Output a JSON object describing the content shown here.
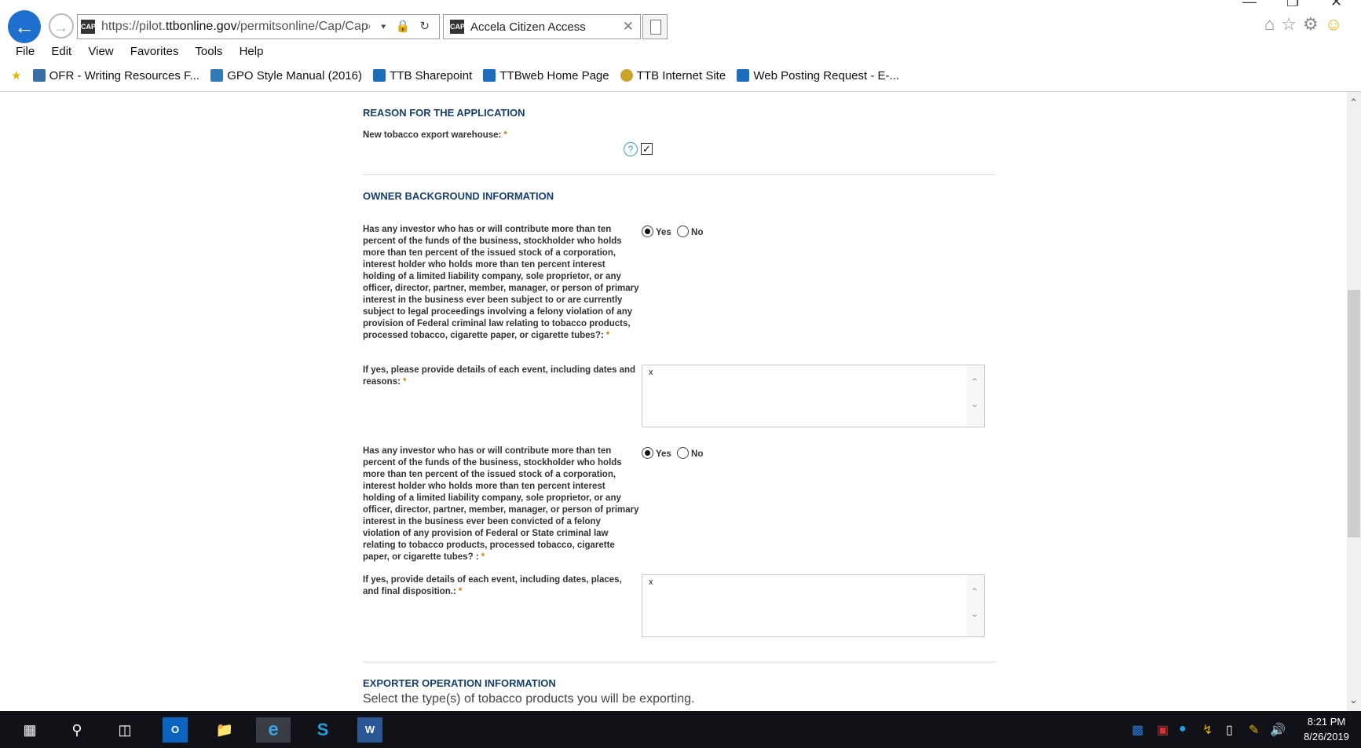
{
  "browser": {
    "url_prefix": "https://pilot.",
    "url_domain": "ttbonline.gov",
    "url_path": "/permitsonline/Cap/Cap",
    "url_tools": "⌕ ▾ 🔒 ↻",
    "favicon_text": "CAP",
    "tab_title": "Accela Citizen Access",
    "tab_close": "✕",
    "menu": [
      "File",
      "Edit",
      "View",
      "Favorites",
      "Tools",
      "Help"
    ],
    "favorites": [
      {
        "label": "OFR - Writing Resources F...",
        "color": "#3b6ea5"
      },
      {
        "label": "GPO Style Manual (2016)",
        "color": "#2f7bb5"
      },
      {
        "label": "TTB Sharepoint",
        "color": "#1c6ebd"
      },
      {
        "label": "TTBweb Home Page",
        "color": "#1c6ebd"
      },
      {
        "label": "TTB Internet Site",
        "color": "#caa42a"
      },
      {
        "label": "Web Posting Request - E-...",
        "color": "#1c6ebd"
      }
    ]
  },
  "form": {
    "sections": {
      "reason": "REASON FOR THE APPLICATION",
      "owner": "OWNER BACKGROUND INFORMATION",
      "exporter": "EXPORTER OPERATION INFORMATION"
    },
    "new_warehouse": {
      "label": "New tobacco export warehouse:",
      "required": "*",
      "checked": true,
      "check_glyph": "✓"
    },
    "q1": {
      "label": "Has any investor who has or will contribute more than ten percent of the funds of the business, stockholder who holds more than ten percent of the issued stock of a corporation, interest holder who holds more than ten percent interest holding of a limited liability company, sole proprietor, or any officer, director, partner, member, manager, or person of primary interest in the business ever been subject to or are currently subject to legal proceedings involving a felony violation of any provision of Federal criminal law relating to tobacco products, processed tobacco, cigarette paper, or cigarette tubes?:",
      "required": "*",
      "yes": "Yes",
      "no": "No",
      "selected": "Yes"
    },
    "q1_details": {
      "label": "If yes, please provide details of each event, including dates and reasons:",
      "required": "*",
      "value": "x"
    },
    "q2": {
      "label": "Has any investor who has or will contribute more than ten percent of the funds of the business, stockholder who holds more than ten percent of the issued stock of a corporation, interest holder who holds more than ten percent interest holding of a limited liability company, sole proprietor, or any officer, director, partner, member, manager, or person of primary interest in the business ever been convicted of a felony violation of any provision of Federal or State criminal law relating to tobacco products, processed tobacco, cigarette paper, or cigarette tubes? :",
      "required": "*",
      "yes": "Yes",
      "no": "No",
      "selected": "Yes"
    },
    "q2_details": {
      "label": "If yes, provide details of each event, including dates, places, and final disposition.:",
      "required": "*",
      "value": "x"
    },
    "exporter_intro": "Select the type(s) of tobacco products you will be exporting.",
    "help_glyph": "?"
  },
  "taskbar": {
    "time": "8:21 PM",
    "date": "8/26/2019"
  }
}
